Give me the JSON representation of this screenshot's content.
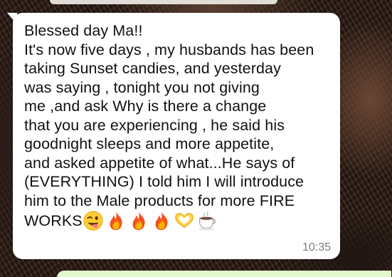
{
  "chat": {
    "message": {
      "lines": [
        "Blessed day Ma!!",
        "It's now five days , my husbands has been",
        "taking Sunset candies, and yesterday",
        "was saying , tonight you not giving",
        "me ,and ask Why is there a change",
        "that you are experiencing , he said his",
        "goodnight sleeps and more appetite,",
        "and asked appetite of what...He says of",
        "(EVERYTHING) I told him I will introduce",
        "him to the Male products for more FIRE",
        "WORKS"
      ],
      "emojis": [
        "winking-tongue-face-icon",
        "fire-icon",
        "fire-icon",
        "fire-icon",
        "heart-hands-icon",
        "hot-beverage-icon"
      ],
      "time": "10:35"
    }
  },
  "colors": {
    "bubble_incoming": "#ffffff",
    "bubble_outgoing": "#e2f7cb",
    "timestamp": "#7d7d7d",
    "text": "#111111"
  }
}
